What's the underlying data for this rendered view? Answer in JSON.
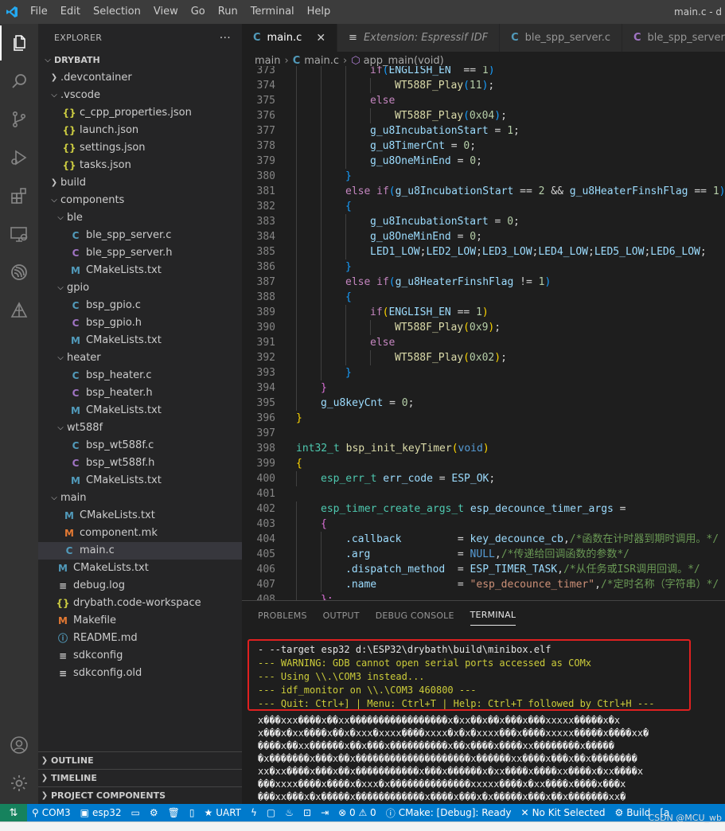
{
  "titlebar": {
    "menus": [
      "File",
      "Edit",
      "Selection",
      "View",
      "Go",
      "Run",
      "Terminal",
      "Help"
    ],
    "title": "main.c - d"
  },
  "activity": [
    "explorer-icon",
    "search-icon",
    "source-control-icon",
    "run-debug-icon",
    "extensions-icon",
    "remote-explorer-icon",
    "espressif-icon",
    "idf-icon",
    "account-icon",
    "settings-gear-icon"
  ],
  "sidebar": {
    "header": "EXPLORER",
    "more": "···",
    "tree": [
      {
        "label": "DRYBATH",
        "depth": 0,
        "kind": "folder-open",
        "bold": true
      },
      {
        "label": ".devcontainer",
        "depth": 1,
        "kind": "folder"
      },
      {
        "label": ".vscode",
        "depth": 1,
        "kind": "folder-open"
      },
      {
        "label": "c_cpp_properties.json",
        "depth": 2,
        "kind": "json"
      },
      {
        "label": "launch.json",
        "depth": 2,
        "kind": "json"
      },
      {
        "label": "settings.json",
        "depth": 2,
        "kind": "json"
      },
      {
        "label": "tasks.json",
        "depth": 2,
        "kind": "json"
      },
      {
        "label": "build",
        "depth": 1,
        "kind": "folder"
      },
      {
        "label": "components",
        "depth": 1,
        "kind": "folder-open"
      },
      {
        "label": "ble",
        "depth": 2,
        "kind": "folder-open"
      },
      {
        "label": "ble_spp_server.c",
        "depth": 3,
        "kind": "c"
      },
      {
        "label": "ble_spp_server.h",
        "depth": 3,
        "kind": "h"
      },
      {
        "label": "CMakeLists.txt",
        "depth": 3,
        "kind": "m"
      },
      {
        "label": "gpio",
        "depth": 2,
        "kind": "folder-open"
      },
      {
        "label": "bsp_gpio.c",
        "depth": 3,
        "kind": "c"
      },
      {
        "label": "bsp_gpio.h",
        "depth": 3,
        "kind": "h"
      },
      {
        "label": "CMakeLists.txt",
        "depth": 3,
        "kind": "m"
      },
      {
        "label": "heater",
        "depth": 2,
        "kind": "folder-open"
      },
      {
        "label": "bsp_heater.c",
        "depth": 3,
        "kind": "c"
      },
      {
        "label": "bsp_heater.h",
        "depth": 3,
        "kind": "h"
      },
      {
        "label": "CMakeLists.txt",
        "depth": 3,
        "kind": "m"
      },
      {
        "label": "wt588f",
        "depth": 2,
        "kind": "folder-open"
      },
      {
        "label": "bsp_wt588f.c",
        "depth": 3,
        "kind": "c"
      },
      {
        "label": "bsp_wt588f.h",
        "depth": 3,
        "kind": "h"
      },
      {
        "label": "CMakeLists.txt",
        "depth": 3,
        "kind": "m"
      },
      {
        "label": "main",
        "depth": 1,
        "kind": "folder-open"
      },
      {
        "label": "CMakeLists.txt",
        "depth": 2,
        "kind": "m"
      },
      {
        "label": "component.mk",
        "depth": 2,
        "kind": "mk"
      },
      {
        "label": "main.c",
        "depth": 2,
        "kind": "c",
        "selected": true
      },
      {
        "label": "CMakeLists.txt",
        "depth": 1,
        "kind": "m"
      },
      {
        "label": "debug.log",
        "depth": 1,
        "kind": "plain"
      },
      {
        "label": "drybath.code-workspace",
        "depth": 1,
        "kind": "json"
      },
      {
        "label": "Makefile",
        "depth": 1,
        "kind": "mk"
      },
      {
        "label": "README.md",
        "depth": 1,
        "kind": "info"
      },
      {
        "label": "sdkconfig",
        "depth": 1,
        "kind": "plain"
      },
      {
        "label": "sdkconfig.old",
        "depth": 1,
        "kind": "plain"
      }
    ],
    "panels": [
      "OUTLINE",
      "TIMELINE",
      "PROJECT COMPONENTS"
    ]
  },
  "editor": {
    "tabs": [
      {
        "icon": "C",
        "label": "main.c",
        "active": true,
        "close": "✕"
      },
      {
        "icon": "≡",
        "label": "Extension: Espressif IDF",
        "italic": true
      },
      {
        "icon": "C",
        "label": "ble_spp_server.c"
      },
      {
        "icon": "C",
        "label": "ble_spp_server.h"
      }
    ],
    "breadcrumb": {
      "folder": "main",
      "file": "main.c",
      "symbol": "app_main(void)"
    },
    "lines": [
      {
        "n": "373",
        "indent": 3,
        "tokens": [
          [
            "ctl",
            "if"
          ],
          [
            "br3",
            "("
          ],
          [
            "var",
            "ENGLISH_EN"
          ],
          [
            "",
            "  == "
          ],
          [
            "num",
            "1"
          ],
          [
            "br3",
            ")"
          ]
        ]
      },
      {
        "n": "374",
        "indent": 4,
        "tokens": [
          [
            "fn",
            "WT588F_Play"
          ],
          [
            "br3",
            "("
          ],
          [
            "num",
            "11"
          ],
          [
            "br3",
            ")"
          ],
          [
            "",
            ";"
          ]
        ]
      },
      {
        "n": "375",
        "indent": 3,
        "tokens": [
          [
            "ctl",
            "else"
          ]
        ]
      },
      {
        "n": "376",
        "indent": 4,
        "tokens": [
          [
            "fn",
            "WT588F_Play"
          ],
          [
            "br3",
            "("
          ],
          [
            "num",
            "0x04"
          ],
          [
            "br3",
            ")"
          ],
          [
            "",
            ";"
          ]
        ]
      },
      {
        "n": "377",
        "indent": 3,
        "tokens": [
          [
            "var",
            "g_u8IncubationStart"
          ],
          [
            "",
            " = "
          ],
          [
            "num",
            "1"
          ],
          [
            "",
            ";"
          ]
        ]
      },
      {
        "n": "378",
        "indent": 3,
        "tokens": [
          [
            "var",
            "g_u8TimerCnt"
          ],
          [
            "",
            " = "
          ],
          [
            "num",
            "0"
          ],
          [
            "",
            ";"
          ]
        ]
      },
      {
        "n": "379",
        "indent": 3,
        "tokens": [
          [
            "var",
            "g_u8OneMinEnd"
          ],
          [
            "",
            " = "
          ],
          [
            "num",
            "0"
          ],
          [
            "",
            ";"
          ]
        ]
      },
      {
        "n": "380",
        "indent": 2,
        "tokens": [
          [
            "br3",
            "}"
          ]
        ]
      },
      {
        "n": "381",
        "indent": 2,
        "tokens": [
          [
            "ctl",
            "else"
          ],
          [
            "",
            " "
          ],
          [
            "ctl",
            "if"
          ],
          [
            "br3",
            "("
          ],
          [
            "var",
            "g_u8IncubationStart"
          ],
          [
            "",
            " == "
          ],
          [
            "num",
            "2"
          ],
          [
            "",
            " && "
          ],
          [
            "var",
            "g_u8HeaterFinshFlag"
          ],
          [
            "",
            " == "
          ],
          [
            "num",
            "1"
          ],
          [
            "br3",
            ")"
          ],
          [
            "cm",
            "/"
          ]
        ]
      },
      {
        "n": "382",
        "indent": 2,
        "tokens": [
          [
            "br3",
            "{"
          ]
        ]
      },
      {
        "n": "383",
        "indent": 3,
        "tokens": [
          [
            "var",
            "g_u8IncubationStart"
          ],
          [
            "",
            " = "
          ],
          [
            "num",
            "0"
          ],
          [
            "",
            ";"
          ]
        ]
      },
      {
        "n": "384",
        "indent": 3,
        "tokens": [
          [
            "var",
            "g_u8OneMinEnd"
          ],
          [
            "",
            " = "
          ],
          [
            "num",
            "0"
          ],
          [
            "",
            ";"
          ]
        ]
      },
      {
        "n": "385",
        "indent": 3,
        "tokens": [
          [
            "var",
            "LED1_LOW"
          ],
          [
            "",
            ";"
          ],
          [
            "var",
            "LED2_LOW"
          ],
          [
            "",
            ";"
          ],
          [
            "var",
            "LED3_LOW"
          ],
          [
            "",
            ";"
          ],
          [
            "var",
            "LED4_LOW"
          ],
          [
            "",
            ";"
          ],
          [
            "var",
            "LED5_LOW"
          ],
          [
            "",
            ";"
          ],
          [
            "var",
            "LED6_LOW"
          ],
          [
            "",
            ";"
          ]
        ]
      },
      {
        "n": "386",
        "indent": 2,
        "tokens": [
          [
            "br3",
            "}"
          ]
        ]
      },
      {
        "n": "387",
        "indent": 2,
        "tokens": [
          [
            "ctl",
            "else"
          ],
          [
            "",
            " "
          ],
          [
            "ctl",
            "if"
          ],
          [
            "br3",
            "("
          ],
          [
            "var",
            "g_u8HeaterFinshFlag"
          ],
          [
            "",
            " != "
          ],
          [
            "num",
            "1"
          ],
          [
            "br3",
            ")"
          ]
        ]
      },
      {
        "n": "388",
        "indent": 2,
        "tokens": [
          [
            "br3",
            "{"
          ]
        ]
      },
      {
        "n": "389",
        "indent": 3,
        "tokens": [
          [
            "ctl",
            "if"
          ],
          [
            "br1",
            "("
          ],
          [
            "var",
            "ENGLISH_EN"
          ],
          [
            "",
            " == "
          ],
          [
            "num",
            "1"
          ],
          [
            "br1",
            ")"
          ]
        ]
      },
      {
        "n": "390",
        "indent": 4,
        "tokens": [
          [
            "fn",
            "WT588F_Play"
          ],
          [
            "br1",
            "("
          ],
          [
            "num",
            "0x9"
          ],
          [
            "br1",
            ")"
          ],
          [
            "",
            ";"
          ]
        ]
      },
      {
        "n": "391",
        "indent": 3,
        "tokens": [
          [
            "ctl",
            "else"
          ]
        ]
      },
      {
        "n": "392",
        "indent": 4,
        "tokens": [
          [
            "fn",
            "WT588F_Play"
          ],
          [
            "br1",
            "("
          ],
          [
            "num",
            "0x02"
          ],
          [
            "br1",
            ")"
          ],
          [
            "",
            ";"
          ]
        ]
      },
      {
        "n": "393",
        "indent": 2,
        "tokens": [
          [
            "br3",
            "}"
          ]
        ]
      },
      {
        "n": "394",
        "indent": 1,
        "tokens": [
          [
            "br2",
            "}"
          ]
        ]
      },
      {
        "n": "395",
        "indent": 1,
        "tokens": [
          [
            "var",
            "g_u8keyCnt"
          ],
          [
            "",
            " = "
          ],
          [
            "num",
            "0"
          ],
          [
            "",
            ";"
          ]
        ]
      },
      {
        "n": "396",
        "indent": 0,
        "tokens": [
          [
            "br1",
            "}"
          ]
        ]
      },
      {
        "n": "397",
        "indent": 0,
        "tokens": []
      },
      {
        "n": "398",
        "indent": 0,
        "tokens": [
          [
            "ty",
            "int32_t"
          ],
          [
            "",
            " "
          ],
          [
            "fn",
            "bsp_init_keyTimer"
          ],
          [
            "br1",
            "("
          ],
          [
            "kw",
            "void"
          ],
          [
            "br1",
            ")"
          ]
        ]
      },
      {
        "n": "399",
        "indent": 0,
        "tokens": [
          [
            "br1",
            "{"
          ]
        ]
      },
      {
        "n": "400",
        "indent": 1,
        "tokens": [
          [
            "ty",
            "esp_err_t"
          ],
          [
            "",
            " "
          ],
          [
            "var",
            "err_code"
          ],
          [
            "",
            " = "
          ],
          [
            "var",
            "ESP_OK"
          ],
          [
            "",
            ";"
          ]
        ]
      },
      {
        "n": "401",
        "indent": 0,
        "tokens": []
      },
      {
        "n": "402",
        "indent": 1,
        "tokens": [
          [
            "ty",
            "esp_timer_create_args_t"
          ],
          [
            "",
            " "
          ],
          [
            "var",
            "esp_decounce_timer_args"
          ],
          [
            "",
            " ="
          ]
        ]
      },
      {
        "n": "403",
        "indent": 1,
        "tokens": [
          [
            "br2",
            "{"
          ]
        ]
      },
      {
        "n": "404",
        "indent": 2,
        "tokens": [
          [
            "",
            ""
          ],
          [
            "var",
            ".callback"
          ],
          [
            "",
            "         = "
          ],
          [
            "var",
            "key_decounce_cb"
          ],
          [
            "",
            ","
          ],
          [
            "cm",
            "/*函数在计时器到期时调用。*/"
          ]
        ]
      },
      {
        "n": "405",
        "indent": 2,
        "tokens": [
          [
            "var",
            ".arg"
          ],
          [
            "",
            "              = "
          ],
          [
            "kw",
            "NULL"
          ],
          [
            "",
            ","
          ],
          [
            "cm",
            "/*传递给回调函数的参数*/"
          ]
        ]
      },
      {
        "n": "406",
        "indent": 2,
        "tokens": [
          [
            "var",
            ".dispatch_method"
          ],
          [
            "",
            "  = "
          ],
          [
            "var",
            "ESP_TIMER_TASK"
          ],
          [
            "",
            ","
          ],
          [
            "cm",
            "/*从任务或ISR调用回调。*/"
          ]
        ]
      },
      {
        "n": "407",
        "indent": 2,
        "tokens": [
          [
            "var",
            ".name"
          ],
          [
            "",
            "             = "
          ],
          [
            "str",
            "\"esp_decounce_timer\""
          ],
          [
            "",
            ","
          ],
          [
            "cm",
            "/*定时名称（字符串）*/"
          ]
        ]
      },
      {
        "n": "408",
        "indent": 1,
        "tokens": [
          [
            "br2",
            "};"
          ]
        ]
      }
    ]
  },
  "panel": {
    "tabs": [
      "PROBLEMS",
      "OUTPUT",
      "DEBUG CONSOLE",
      "TERMINAL"
    ],
    "active": "TERMINAL",
    "terminal_lines": [
      {
        "text": "- --target esp32 d:\\ESP32\\drybath\\build\\minibox.elf",
        "color": "white"
      },
      {
        "text": "--- WARNING: GDB cannot open serial ports accessed as COMx",
        "color": "yellow"
      },
      {
        "text": "--- Using \\\\.\\COM3 instead...",
        "color": "yellow"
      },
      {
        "text": "--- idf_monitor on \\\\.\\COM3 460800 ---",
        "color": "yellow"
      },
      {
        "text": "--- Quit: Ctrl+] | Menu: Ctrl+T | Help: Ctrl+T followed by Ctrl+H ---",
        "color": "yellow"
      }
    ],
    "garbage_lines": [
      "x���xxx����x��xx�����������������x�xx��x��x���x���xxxxx�����x�x",
      "x���x�xx����x��x�xxx�xxxx����xxxx�x�x�xxxx���x����xxxxx�����x����xx�",
      "����x��xx������x��x���x����������x��x����x����xx��������x�����",
      "�x�������x���x��x��������������������x������xx����x���x��x��������",
      "xx�xx����x���x��x�����������x���x������x�xx����x����xx����x�xx����x",
      "���xxxx����x����x�xxx�x��������������xxxxx����x�xx����x����x���x",
      "���xx���x�x�����x������������x����x���x�x�����x���x��x�������xx�"
    ]
  },
  "status": {
    "items": [
      "COM3",
      "esp32",
      "UART",
      "⊗ 0 ⚠ 0",
      "CMake: [Debug]: Ready",
      "No Kit Selected",
      "Build",
      "[a"
    ],
    "watermark": "CSDN @MCU_wb"
  }
}
